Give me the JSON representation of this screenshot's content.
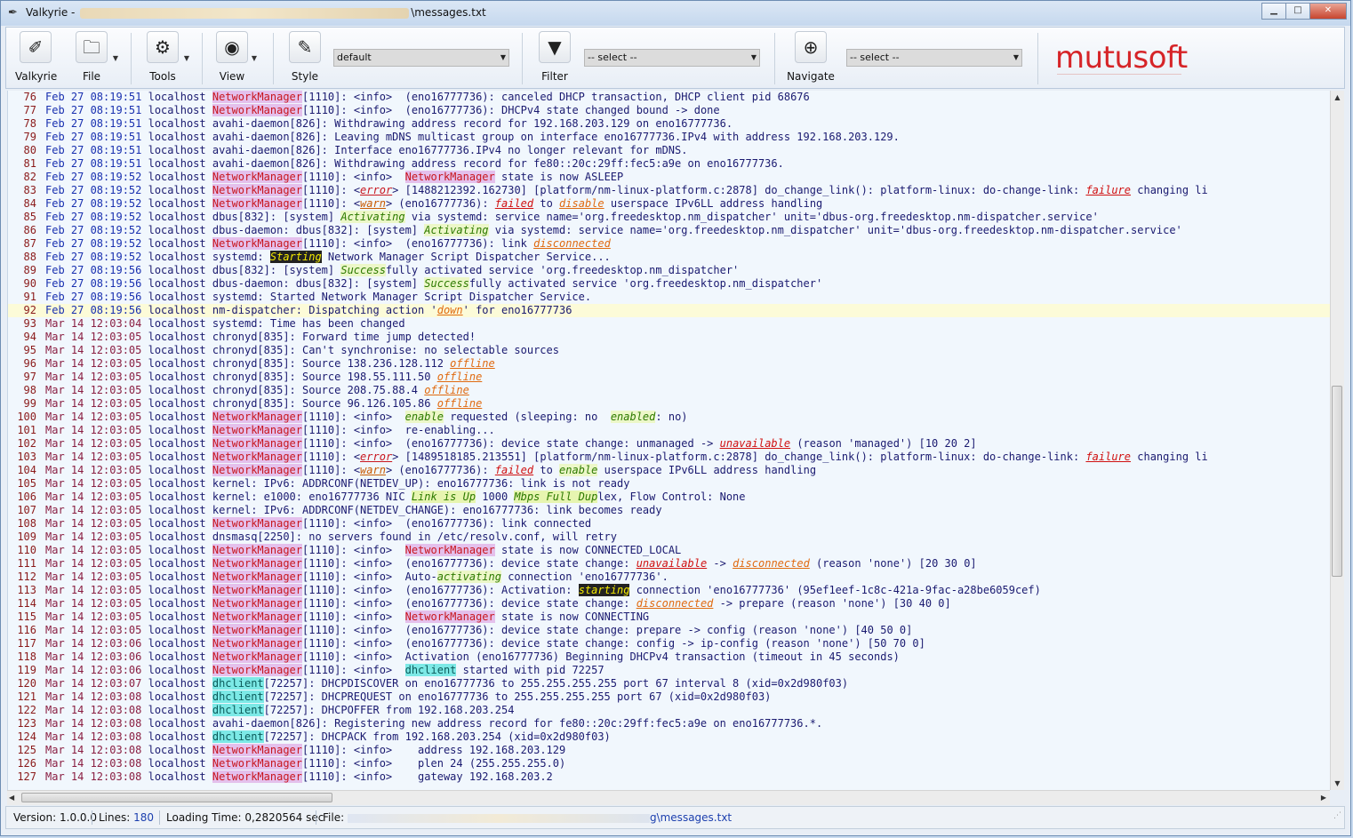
{
  "window": {
    "title_prefix": "Valkyrie - ",
    "title_suffix": "\\messages.txt",
    "minimize": "▁",
    "maximize": "□",
    "close": "✕"
  },
  "toolbar": {
    "valkyrie": "Valkyrie",
    "file": "File",
    "tools": "Tools",
    "view": "View",
    "style": "Style",
    "style_value": "default",
    "filter": "Filter",
    "filter_value": "-- select --",
    "navigate": "Navigate",
    "navigate_value": "-- select --",
    "logo": "mutusoft"
  },
  "lines": [
    {
      "n": "76",
      "ts": "Feb 27 08:19:51",
      "p": [
        [
          "t",
          " localhost "
        ],
        [
          "nm",
          "NetworkManager"
        ],
        [
          "t",
          "[1110]: <info>  (eno16777736): canceled DHCP transaction, DHCP client pid 68676"
        ]
      ]
    },
    {
      "n": "77",
      "ts": "Feb 27 08:19:51",
      "p": [
        [
          "t",
          " localhost "
        ],
        [
          "nm",
          "NetworkManager"
        ],
        [
          "t",
          "[1110]: <info>  (eno16777736): DHCPv4 state changed bound -> done"
        ]
      ]
    },
    {
      "n": "78",
      "ts": "Feb 27 08:19:51",
      "p": [
        [
          "t",
          " localhost avahi-daemon[826]: Withdrawing address record for 192.168.203.129 on eno16777736."
        ]
      ]
    },
    {
      "n": "79",
      "ts": "Feb 27 08:19:51",
      "p": [
        [
          "t",
          " localhost avahi-daemon[826]: Leaving mDNS multicast group on interface eno16777736.IPv4 with address 192.168.203.129."
        ]
      ]
    },
    {
      "n": "80",
      "ts": "Feb 27 08:19:51",
      "p": [
        [
          "t",
          " localhost avahi-daemon[826]: Interface eno16777736.IPv4 no longer relevant for mDNS."
        ]
      ]
    },
    {
      "n": "81",
      "ts": "Feb 27 08:19:51",
      "p": [
        [
          "t",
          " localhost avahi-daemon[826]: Withdrawing address record for fe80::20c:29ff:fec5:a9e on eno16777736."
        ]
      ]
    },
    {
      "n": "82",
      "ts": "Feb 27 08:19:52",
      "p": [
        [
          "t",
          " localhost "
        ],
        [
          "nm",
          "NetworkManager"
        ],
        [
          "t",
          "[1110]: <info>  "
        ],
        [
          "nm",
          "NetworkManager"
        ],
        [
          "t",
          " state is now ASLEEP"
        ]
      ]
    },
    {
      "n": "83",
      "ts": "Feb 27 08:19:52",
      "p": [
        [
          "t",
          " localhost "
        ],
        [
          "nm",
          "NetworkManager"
        ],
        [
          "t",
          "[1110]: <"
        ],
        [
          "err",
          "error"
        ],
        [
          "t",
          "> [1488212392.162730] [platform/nm-linux-platform.c:2878] do_change_link(): platform-linux: do-change-link: "
        ],
        [
          "fail",
          "failure"
        ],
        [
          "t",
          " changing li"
        ]
      ]
    },
    {
      "n": "84",
      "ts": "Feb 27 08:19:52",
      "p": [
        [
          "t",
          " localhost "
        ],
        [
          "nm",
          "NetworkManager"
        ],
        [
          "t",
          "[1110]: <"
        ],
        [
          "warn",
          "warn"
        ],
        [
          "t",
          "> (eno16777736): "
        ],
        [
          "fail",
          "failed"
        ],
        [
          "t",
          " to "
        ],
        [
          "disc",
          "disable"
        ],
        [
          "t",
          " userspace IPv6LL address handling"
        ]
      ]
    },
    {
      "n": "85",
      "ts": "Feb 27 08:19:52",
      "p": [
        [
          "t",
          " localhost dbus[832]: [system] "
        ],
        [
          "green",
          "Activating"
        ],
        [
          "t",
          " via systemd: service name='org.freedesktop.nm_dispatcher' unit='dbus-org.freedesktop.nm-dispatcher.service'"
        ]
      ]
    },
    {
      "n": "86",
      "ts": "Feb 27 08:19:52",
      "p": [
        [
          "t",
          " localhost dbus-daemon: dbus[832]: [system] "
        ],
        [
          "green",
          "Activating"
        ],
        [
          "t",
          " via systemd: service name='org.freedesktop.nm_dispatcher' unit='dbus-org.freedesktop.nm-dispatcher.service'"
        ]
      ]
    },
    {
      "n": "87",
      "ts": "Feb 27 08:19:52",
      "p": [
        [
          "t",
          " localhost "
        ],
        [
          "nm",
          "NetworkManager"
        ],
        [
          "t",
          "[1110]: <info>  (eno16777736): link "
        ],
        [
          "disc",
          "disconnected"
        ]
      ]
    },
    {
      "n": "88",
      "ts": "Feb 27 08:19:52",
      "p": [
        [
          "t",
          " localhost systemd: "
        ],
        [
          "hl",
          "Starting"
        ],
        [
          "t",
          " Network Manager Script Dispatcher Service..."
        ]
      ]
    },
    {
      "n": "89",
      "ts": "Feb 27 08:19:56",
      "p": [
        [
          "t",
          " localhost dbus[832]: [system] "
        ],
        [
          "green",
          "Success"
        ],
        [
          "t",
          "fully activated service 'org.freedesktop.nm_dispatcher'"
        ]
      ]
    },
    {
      "n": "90",
      "ts": "Feb 27 08:19:56",
      "p": [
        [
          "t",
          " localhost dbus-daemon: dbus[832]: [system] "
        ],
        [
          "green",
          "Success"
        ],
        [
          "t",
          "fully activated service 'org.freedesktop.nm_dispatcher'"
        ]
      ]
    },
    {
      "n": "91",
      "ts": "Feb 27 08:19:56",
      "p": [
        [
          "t",
          " localhost systemd: Started Network Manager Script Dispatcher Service."
        ]
      ]
    },
    {
      "n": "92",
      "ts": "Feb 27 08:19:56",
      "cur": true,
      "p": [
        [
          "t",
          " localhost nm-dispatcher: Dispatching action '"
        ],
        [
          "disc",
          "down"
        ],
        [
          "t",
          "' for eno16777736"
        ]
      ]
    },
    {
      "n": "93",
      "ts": "Mar 14 12:03:04",
      "p": [
        [
          "t",
          " localhost systemd: Time has been changed"
        ]
      ]
    },
    {
      "n": "94",
      "ts": "Mar 14 12:03:05",
      "p": [
        [
          "t",
          " localhost chronyd[835]: Forward time jump detected!"
        ]
      ]
    },
    {
      "n": "95",
      "ts": "Mar 14 12:03:05",
      "p": [
        [
          "t",
          " localhost chronyd[835]: Can't synchronise: no selectable sources"
        ]
      ]
    },
    {
      "n": "96",
      "ts": "Mar 14 12:03:05",
      "p": [
        [
          "t",
          " localhost chronyd[835]: Source 138.236.128.112 "
        ],
        [
          "disc",
          "offline"
        ]
      ]
    },
    {
      "n": "97",
      "ts": "Mar 14 12:03:05",
      "p": [
        [
          "t",
          " localhost chronyd[835]: Source 198.55.111.50 "
        ],
        [
          "disc",
          "offline"
        ]
      ]
    },
    {
      "n": "98",
      "ts": "Mar 14 12:03:05",
      "p": [
        [
          "t",
          " localhost chronyd[835]: Source 208.75.88.4 "
        ],
        [
          "disc",
          "offline"
        ]
      ]
    },
    {
      "n": "99",
      "ts": "Mar 14 12:03:05",
      "p": [
        [
          "t",
          " localhost chronyd[835]: Source 96.126.105.86 "
        ],
        [
          "disc",
          "offline"
        ]
      ]
    },
    {
      "n": "100",
      "ts": "Mar 14 12:03:05",
      "p": [
        [
          "t",
          " localhost "
        ],
        [
          "nm",
          "NetworkManager"
        ],
        [
          "t",
          "[1110]: <info>  "
        ],
        [
          "green",
          "enable"
        ],
        [
          "t",
          " requested (sleeping: no  "
        ],
        [
          "green",
          "enabled"
        ],
        [
          "t",
          ": no)"
        ]
      ]
    },
    {
      "n": "101",
      "ts": "Mar 14 12:03:05",
      "p": [
        [
          "t",
          " localhost "
        ],
        [
          "nm",
          "NetworkManager"
        ],
        [
          "t",
          "[1110]: <info>  re-enabling..."
        ]
      ]
    },
    {
      "n": "102",
      "ts": "Mar 14 12:03:05",
      "p": [
        [
          "t",
          " localhost "
        ],
        [
          "nm",
          "NetworkManager"
        ],
        [
          "t",
          "[1110]: <info>  (eno16777736): device state change: unmanaged -> "
        ],
        [
          "fail",
          "unavailable"
        ],
        [
          "t",
          " (reason 'managed') [10 20 2]"
        ]
      ]
    },
    {
      "n": "103",
      "ts": "Mar 14 12:03:05",
      "p": [
        [
          "t",
          " localhost "
        ],
        [
          "nm",
          "NetworkManager"
        ],
        [
          "t",
          "[1110]: <"
        ],
        [
          "err",
          "error"
        ],
        [
          "t",
          "> [1489518185.213551] [platform/nm-linux-platform.c:2878] do_change_link(): platform-linux: do-change-link: "
        ],
        [
          "fail",
          "failure"
        ],
        [
          "t",
          " changing li"
        ]
      ]
    },
    {
      "n": "104",
      "ts": "Mar 14 12:03:05",
      "p": [
        [
          "t",
          " localhost "
        ],
        [
          "nm",
          "NetworkManager"
        ],
        [
          "t",
          "[1110]: <"
        ],
        [
          "warn",
          "warn"
        ],
        [
          "t",
          "> (eno16777736): "
        ],
        [
          "fail",
          "failed"
        ],
        [
          "t",
          " to "
        ],
        [
          "green",
          "enable"
        ],
        [
          "t",
          " userspace IPv6LL address handling"
        ]
      ]
    },
    {
      "n": "105",
      "ts": "Mar 14 12:03:05",
      "p": [
        [
          "t",
          " localhost kernel: IPv6: ADDRCONF(NETDEV_UP): eno16777736: link is not ready"
        ]
      ]
    },
    {
      "n": "106",
      "ts": "Mar 14 12:03:05",
      "p": [
        [
          "t",
          " localhost kernel: e1000: eno16777736 NIC "
        ],
        [
          "hl2",
          "Link is Up"
        ],
        [
          "t",
          " 1000 "
        ],
        [
          "hl2",
          "Mbps Full Dup"
        ],
        [
          "t",
          "lex, Flow Control: None"
        ]
      ]
    },
    {
      "n": "107",
      "ts": "Mar 14 12:03:05",
      "p": [
        [
          "t",
          " localhost kernel: IPv6: ADDRCONF(NETDEV_CHANGE): eno16777736: link becomes ready"
        ]
      ]
    },
    {
      "n": "108",
      "ts": "Mar 14 12:03:05",
      "p": [
        [
          "t",
          " localhost "
        ],
        [
          "nm",
          "NetworkManager"
        ],
        [
          "t",
          "[1110]: <info>  (eno16777736): link connected"
        ]
      ]
    },
    {
      "n": "109",
      "ts": "Mar 14 12:03:05",
      "p": [
        [
          "t",
          " localhost dnsmasq[2250]: no servers found in /etc/resolv.conf, will retry"
        ]
      ]
    },
    {
      "n": "110",
      "ts": "Mar 14 12:03:05",
      "p": [
        [
          "t",
          " localhost "
        ],
        [
          "nm",
          "NetworkManager"
        ],
        [
          "t",
          "[1110]: <info>  "
        ],
        [
          "nm",
          "NetworkManager"
        ],
        [
          "t",
          " state is now CONNECTED_LOCAL"
        ]
      ]
    },
    {
      "n": "111",
      "ts": "Mar 14 12:03:05",
      "p": [
        [
          "t",
          " localhost "
        ],
        [
          "nm",
          "NetworkManager"
        ],
        [
          "t",
          "[1110]: <info>  (eno16777736): device state change: "
        ],
        [
          "fail",
          "unavailable"
        ],
        [
          "t",
          " -> "
        ],
        [
          "disc",
          "disconnected"
        ],
        [
          "t",
          " (reason 'none') [20 30 0]"
        ]
      ]
    },
    {
      "n": "112",
      "ts": "Mar 14 12:03:05",
      "p": [
        [
          "t",
          " localhost "
        ],
        [
          "nm",
          "NetworkManager"
        ],
        [
          "t",
          "[1110]: <info>  Auto-"
        ],
        [
          "green",
          "activating"
        ],
        [
          "t",
          " connection 'eno16777736'."
        ]
      ]
    },
    {
      "n": "113",
      "ts": "Mar 14 12:03:05",
      "p": [
        [
          "t",
          " localhost "
        ],
        [
          "nm",
          "NetworkManager"
        ],
        [
          "t",
          "[1110]: <info>  (eno16777736): Activation: "
        ],
        [
          "hl",
          "starting"
        ],
        [
          "t",
          " connection 'eno16777736' (95ef1eef-1c8c-421a-9fac-a28be6059cef)"
        ]
      ]
    },
    {
      "n": "114",
      "ts": "Mar 14 12:03:05",
      "p": [
        [
          "t",
          " localhost "
        ],
        [
          "nm",
          "NetworkManager"
        ],
        [
          "t",
          "[1110]: <info>  (eno16777736): device state change: "
        ],
        [
          "disc",
          "disconnected"
        ],
        [
          "t",
          " -> prepare (reason 'none') [30 40 0]"
        ]
      ]
    },
    {
      "n": "115",
      "ts": "Mar 14 12:03:05",
      "p": [
        [
          "t",
          " localhost "
        ],
        [
          "nm",
          "NetworkManager"
        ],
        [
          "t",
          "[1110]: <info>  "
        ],
        [
          "nm",
          "NetworkManager"
        ],
        [
          "t",
          " state is now CONNECTING"
        ]
      ]
    },
    {
      "n": "116",
      "ts": "Mar 14 12:03:05",
      "p": [
        [
          "t",
          " localhost "
        ],
        [
          "nm",
          "NetworkManager"
        ],
        [
          "t",
          "[1110]: <info>  (eno16777736): device state change: prepare -> config (reason 'none') [40 50 0]"
        ]
      ]
    },
    {
      "n": "117",
      "ts": "Mar 14 12:03:06",
      "p": [
        [
          "t",
          " localhost "
        ],
        [
          "nm",
          "NetworkManager"
        ],
        [
          "t",
          "[1110]: <info>  (eno16777736): device state change: config -> ip-config (reason 'none') [50 70 0]"
        ]
      ]
    },
    {
      "n": "118",
      "ts": "Mar 14 12:03:06",
      "p": [
        [
          "t",
          " localhost "
        ],
        [
          "nm",
          "NetworkManager"
        ],
        [
          "t",
          "[1110]: <info>  Activation (eno16777736) Beginning DHCPv4 transaction (timeout in 45 seconds)"
        ]
      ]
    },
    {
      "n": "119",
      "ts": "Mar 14 12:03:06",
      "p": [
        [
          "t",
          " localhost "
        ],
        [
          "nm",
          "NetworkManager"
        ],
        [
          "t",
          "[1110]: <info>  "
        ],
        [
          "dh",
          "dhclient"
        ],
        [
          "t",
          " started with pid 72257"
        ]
      ]
    },
    {
      "n": "120",
      "ts": "Mar 14 12:03:07",
      "p": [
        [
          "t",
          " localhost "
        ],
        [
          "dh",
          "dhclient"
        ],
        [
          "t",
          "[72257]: DHCPDISCOVER on eno16777736 to 255.255.255.255 port 67 interval 8 (xid=0x2d980f03)"
        ]
      ]
    },
    {
      "n": "121",
      "ts": "Mar 14 12:03:08",
      "p": [
        [
          "t",
          " localhost "
        ],
        [
          "dh",
          "dhclient"
        ],
        [
          "t",
          "[72257]: DHCPREQUEST on eno16777736 to 255.255.255.255 port 67 (xid=0x2d980f03)"
        ]
      ]
    },
    {
      "n": "122",
      "ts": "Mar 14 12:03:08",
      "p": [
        [
          "t",
          " localhost "
        ],
        [
          "dh",
          "dhclient"
        ],
        [
          "t",
          "[72257]: DHCPOFFER from 192.168.203.254"
        ]
      ]
    },
    {
      "n": "123",
      "ts": "Mar 14 12:03:08",
      "p": [
        [
          "t",
          " localhost avahi-daemon[826]: Registering new address record for fe80::20c:29ff:fec5:a9e on eno16777736.*."
        ]
      ]
    },
    {
      "n": "124",
      "ts": "Mar 14 12:03:08",
      "p": [
        [
          "t",
          " localhost "
        ],
        [
          "dh",
          "dhclient"
        ],
        [
          "t",
          "[72257]: DHCPACK from 192.168.203.254 (xid=0x2d980f03)"
        ]
      ]
    },
    {
      "n": "125",
      "ts": "Mar 14 12:03:08",
      "p": [
        [
          "t",
          " localhost "
        ],
        [
          "nm",
          "NetworkManager"
        ],
        [
          "t",
          "[1110]: <info>    address 192.168.203.129"
        ]
      ]
    },
    {
      "n": "126",
      "ts": "Mar 14 12:03:08",
      "p": [
        [
          "t",
          " localhost "
        ],
        [
          "nm",
          "NetworkManager"
        ],
        [
          "t",
          "[1110]: <info>    plen 24 (255.255.255.0)"
        ]
      ]
    },
    {
      "n": "127",
      "ts": "Mar 14 12:03:08",
      "p": [
        [
          "t",
          " localhost "
        ],
        [
          "nm",
          "NetworkManager"
        ],
        [
          "t",
          "[1110]: <info>    gateway 192.168.203.2"
        ]
      ]
    }
  ],
  "status": {
    "version_label": "Version:",
    "version": "1.0.0.0",
    "lines_label": "Lines:",
    "lines": "180",
    "loading_label": "Loading Time:",
    "loading": "0,2820564 sec",
    "file_label": "File:",
    "file_suffix": "g\\messages.txt"
  },
  "colors": {
    "networkmanager_bg": "#e4c0ec",
    "dhclient_bg": "#7ce9e6",
    "logo": "#d62428"
  }
}
